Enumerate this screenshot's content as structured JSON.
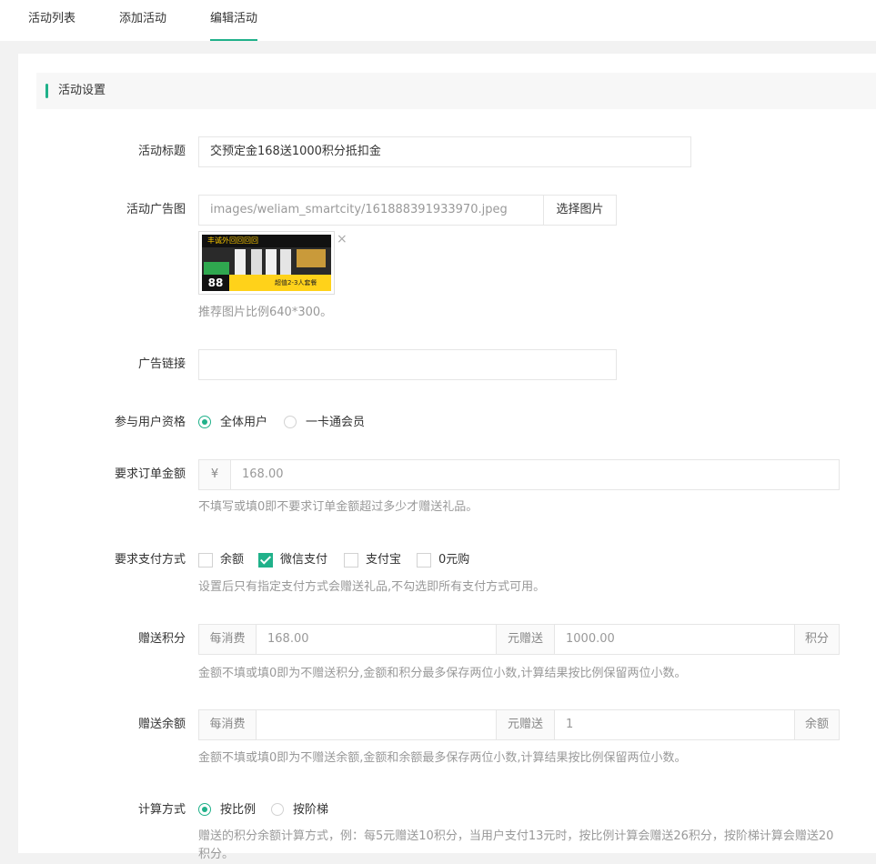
{
  "tabs": [
    {
      "label": "活动列表"
    },
    {
      "label": "添加活动"
    },
    {
      "label": "编辑活动",
      "active": true
    }
  ],
  "section": {
    "title": "活动设置"
  },
  "form": {
    "title": {
      "label": "活动标题",
      "value": "交预定金168送1000积分抵扣金"
    },
    "ad_image": {
      "label": "活动广告图",
      "value": "images/weliam_smartcity/161888391933970.jpeg",
      "button": "选择图片",
      "remove": "×",
      "help": "推荐图片比例640*300。",
      "thumb_text": {
        "banner": "丰诚外回回回回",
        "badge": "88",
        "bottom": "超值2-3人套餐"
      }
    },
    "ad_link": {
      "label": "广告链接",
      "value": ""
    },
    "user_qual": {
      "label": "参与用户资格",
      "options": [
        {
          "label": "全体用户",
          "checked": true
        },
        {
          "label": "一卡通会员",
          "checked": false
        }
      ]
    },
    "order_amount": {
      "label": "要求订单金额",
      "prefix": "¥",
      "value": "168.00",
      "help": "不填写或填0即不要求订单金额超过多少才赠送礼品。"
    },
    "pay_methods": {
      "label": "要求支付方式",
      "options": [
        {
          "label": "余额",
          "checked": false
        },
        {
          "label": "微信支付",
          "checked": true
        },
        {
          "label": "支付宝",
          "checked": false
        },
        {
          "label": "0元购",
          "checked": false
        }
      ],
      "help": "设置后只有指定支付方式会赠送礼品,不勾选即所有支付方式可用。"
    },
    "gift_points": {
      "label": "赠送积分",
      "prefix": "每消费",
      "amount": "168.00",
      "mid": "元赠送",
      "points": "1000.00",
      "suffix": "积分",
      "help": "金额不填或填0即为不赠送积分,金额和积分最多保存两位小数,计算结果按比例保留两位小数。"
    },
    "gift_balance": {
      "label": "赠送余额",
      "prefix": "每消费",
      "amount": "",
      "mid": "元赠送",
      "balance": "1",
      "suffix": "余额",
      "help": "金额不填或填0即为不赠送余额,金额和余额最多保存两位小数,计算结果按比例保留两位小数。"
    },
    "calc_method": {
      "label": "计算方式",
      "options": [
        {
          "label": "按比例",
          "checked": true
        },
        {
          "label": "按阶梯",
          "checked": false
        }
      ],
      "help": "赠送的积分余额计算方式，例：每5元赠送10积分，当用户支付13元时，按比例计算会赠送26积分，按阶梯计算会赠送20积分。"
    }
  },
  "colors": {
    "accent": "#20b18a",
    "border": "#e6e6e6",
    "help_text": "#999999"
  }
}
